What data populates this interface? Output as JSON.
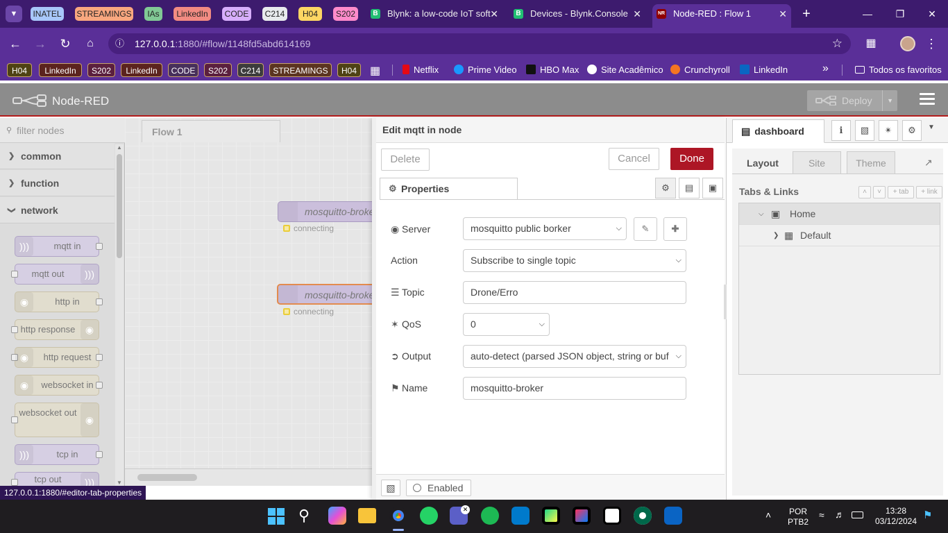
{
  "browser": {
    "tab_groups": [
      {
        "label": "INATEL",
        "color": "#a8c7fa"
      },
      {
        "label": "STREAMINGS",
        "color": "#f9a77f"
      },
      {
        "label": "IAs",
        "color": "#81c995"
      },
      {
        "label": "LinkedIn",
        "color": "#f28b82"
      },
      {
        "label": "CODE",
        "color": "#d7aefb"
      },
      {
        "label": "C214",
        "color": "#e8eaed"
      },
      {
        "label": "H04",
        "color": "#fdd663"
      },
      {
        "label": "S202",
        "color": "#ff8bcb"
      }
    ],
    "tabs": [
      {
        "title": "Blynk: a low-code IoT soft",
        "favicon": "B",
        "active": false
      },
      {
        "title": "Devices - Blynk.Console",
        "favicon": "B",
        "active": false
      },
      {
        "title": "Node-RED : Flow 1",
        "favicon": "NR",
        "active": true
      }
    ],
    "url_host": "127.0.0.1",
    "url_rest": ":1880/#flow/1148fd5abd614169",
    "bookmark_groups": [
      "H04",
      "LinkedIn",
      "S202",
      "LinkedIn",
      "CODE",
      "S202",
      "C214",
      "STREAMINGS",
      "H04"
    ],
    "bookmarks": [
      {
        "label": "Netflix",
        "color": "#e50914"
      },
      {
        "label": "Prime Video",
        "color": "#1a98ff"
      },
      {
        "label": "HBO Max",
        "color": "#7b2cbf"
      },
      {
        "label": "Site Acadêmico",
        "color": "#ffffff"
      },
      {
        "label": "Crunchyroll",
        "color": "#f47521"
      },
      {
        "label": "LinkedIn",
        "color": "#0a66c2"
      }
    ],
    "all_bookmarks": "Todos os favoritos",
    "status_url": "127.0.0.1:1880/#editor-tab-properties"
  },
  "nodered": {
    "app_title": "Node-RED",
    "deploy_label": "Deploy",
    "filter_placeholder": "filter nodes",
    "categories": [
      "common",
      "function",
      "network"
    ],
    "palette_nodes": [
      "mqtt in",
      "mqtt out",
      "http in",
      "http response",
      "http request",
      "websocket in",
      "websocket out",
      "tcp in",
      "tcp out"
    ],
    "flow_tab": "Flow 1",
    "flow_nodes": [
      {
        "label": "mosquitto-broker",
        "status": "connecting"
      },
      {
        "label": "mosquitto-broker",
        "status": "connecting"
      }
    ]
  },
  "editor": {
    "title": "Edit mqtt in node",
    "delete_label": "Delete",
    "cancel_label": "Cancel",
    "done_label": "Done",
    "properties_tab": "Properties",
    "fields": {
      "server_label": "Server",
      "server_value": "mosquitto public borker",
      "action_label": "Action",
      "action_value": "Subscribe to single topic",
      "topic_label": "Topic",
      "topic_value": "Drone/Erro",
      "qos_label": "QoS",
      "qos_value": "0",
      "output_label": "Output",
      "output_value": "auto-detect (parsed JSON object, string or buf",
      "name_label": "Name",
      "name_value": "mosquitto-broker"
    },
    "enabled_label": "Enabled"
  },
  "sidebar": {
    "tab_label": "dashboard",
    "subtabs": [
      "Layout",
      "Site",
      "Theme"
    ],
    "tabs_links_label": "Tabs & Links",
    "tab_btn": "+ tab",
    "link_btn": "+ link",
    "tree": [
      {
        "label": "Home"
      },
      {
        "label": "Default"
      }
    ]
  },
  "taskbar": {
    "lang_top": "POR",
    "lang_bottom": "PTB2",
    "time": "13:28",
    "date": "03/12/2024"
  }
}
